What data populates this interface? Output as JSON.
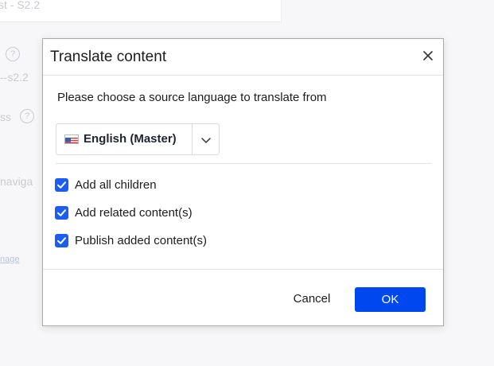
{
  "background": {
    "field_text": "st - S2.2",
    "slug_text": "--s2.2",
    "label_ss": "ss",
    "label_navig": "naviga",
    "link_text": "nage",
    "help_glyph": "?"
  },
  "dialog": {
    "title": "Translate content",
    "close_glyph": "close-icon",
    "prompt": "Please choose a source language to translate from",
    "language": {
      "selected": "English (Master)",
      "flag": "us-flag-icon"
    },
    "options": [
      {
        "label": "Add all children",
        "checked": true
      },
      {
        "label": "Add related content(s)",
        "checked": true
      },
      {
        "label": "Publish added content(s)",
        "checked": true
      }
    ],
    "cancel_label": "Cancel",
    "ok_label": "OK"
  },
  "colors": {
    "accent": "#0047f0",
    "checkbox": "#1a5df5"
  }
}
